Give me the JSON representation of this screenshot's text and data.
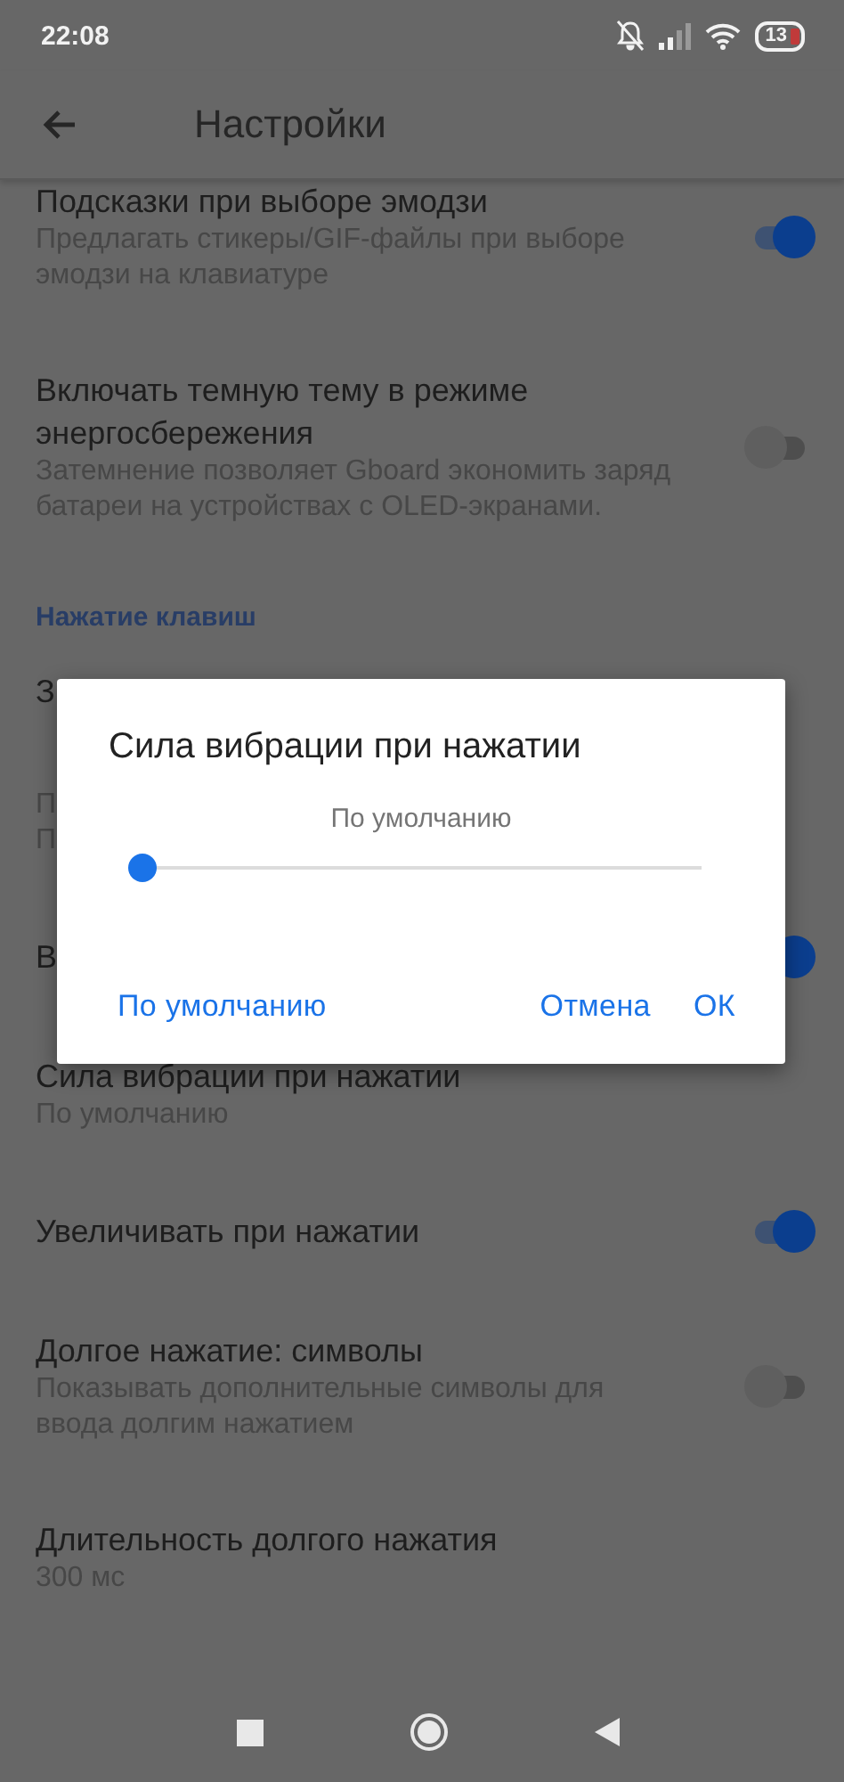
{
  "status_bar": {
    "time": "22:08",
    "battery": "13"
  },
  "app_bar": {
    "title": "Настройки"
  },
  "settings": [
    {
      "kind": "toggle",
      "title": "Подсказки при выборе эмодзи",
      "summary": "Предлагать стикеры/GIF-файлы при выборе эмодзи на клавиатуре",
      "on": true
    },
    {
      "kind": "toggle",
      "title": "Включать темную тему в режиме энергосбережения",
      "summary": "Затемнение позволяет Gboard экономить заряд батареи на устройствах с OLED-экранами.",
      "on": false
    },
    {
      "kind": "header",
      "title": "Нажатие клавиш"
    },
    {
      "kind": "text",
      "title": "З"
    },
    {
      "kind": "text",
      "summary": "П\nП"
    },
    {
      "kind": "toggle",
      "title": "В",
      "on": true
    },
    {
      "kind": "text",
      "title": "Сила вибрации при нажатии",
      "summary": "По умолчанию"
    },
    {
      "kind": "toggle",
      "title": "Увеличивать при нажатии",
      "on": true
    },
    {
      "kind": "toggle",
      "title": "Долгое нажатие: символы",
      "summary": "Показывать дополнительные символы для ввода долгим нажатием",
      "on": false
    },
    {
      "kind": "text",
      "title": "Длительность долгого нажатия",
      "summary": "300 мс"
    }
  ],
  "dialog": {
    "title": "Сила вибрации при нажатии",
    "value_label": "По умолчанию",
    "level": 0.0,
    "buttons": [
      "По умолчанию",
      "Отмена",
      "ОК"
    ]
  }
}
